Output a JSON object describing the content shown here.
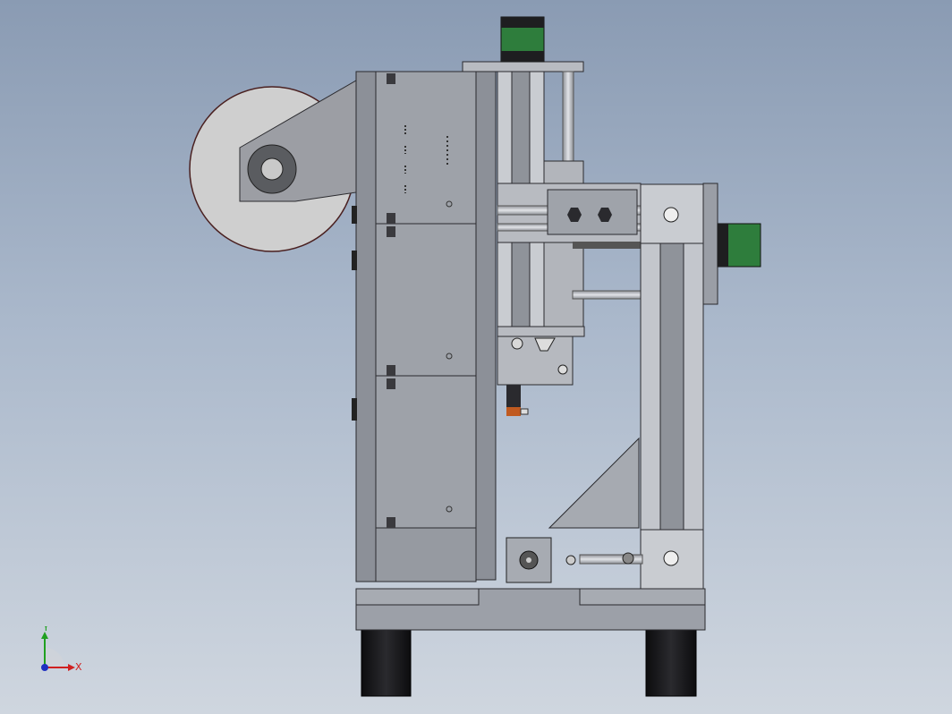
{
  "viewport": {
    "background_top": "#8a9bb3",
    "background_bottom": "#cfd6df"
  },
  "model": {
    "colors": {
      "housing": "#9a9ea6",
      "housing_dark": "#7c8089",
      "aluminum": "#c9ccd1",
      "motor_green": "#2e7d3c",
      "motor_black": "#1e1e20",
      "drum": "#cfcfcf",
      "edge": "#2a2a2e"
    },
    "parts": [
      "spool-drum",
      "main-housing",
      "vertical-axis",
      "horizontal-axis",
      "aluminum-extrusion-frame",
      "stepper-motor-top",
      "stepper-motor-right",
      "stepper-motor-bottom",
      "hotend",
      "feet"
    ]
  },
  "triad": {
    "x_label": "X",
    "y_label": "Y",
    "x_color": "#d02020",
    "y_color": "#20a020",
    "z_color": "#2030c0"
  }
}
